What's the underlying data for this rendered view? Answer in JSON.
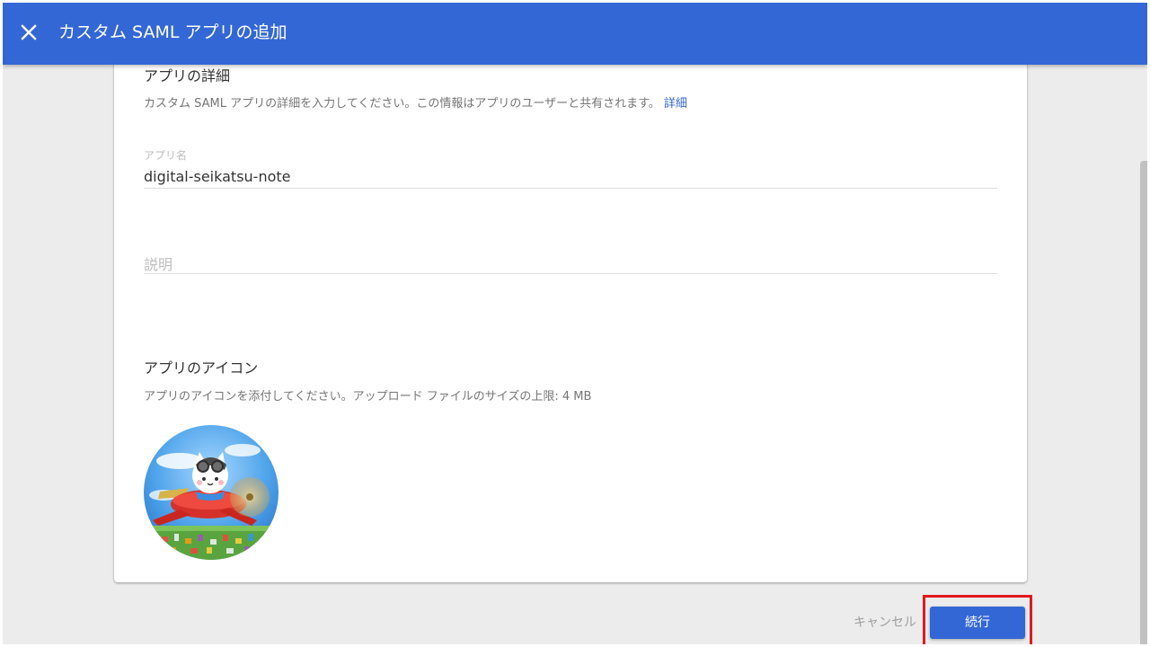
{
  "header": {
    "title": "カスタム SAML アプリの追加",
    "bg_color": "#3367d6"
  },
  "app_details": {
    "title": "アプリの詳細",
    "description": "カスタム SAML アプリの詳細を入力してください。この情報はアプリのユーザーと共有されます。",
    "link": "詳細"
  },
  "app_name": {
    "label": "アプリ名",
    "value": "digital-seikatsu-note"
  },
  "description_field": {
    "placeholder": "説明"
  },
  "app_icon": {
    "title": "アプリのアイコン",
    "description": "アプリのアイコンを添付してください。アップロード ファイルのサイズの上限: 4 MB"
  },
  "footer": {
    "cancel_label": "キャンセル",
    "continue_label": "続行",
    "highlight_color": "#e0191f"
  }
}
